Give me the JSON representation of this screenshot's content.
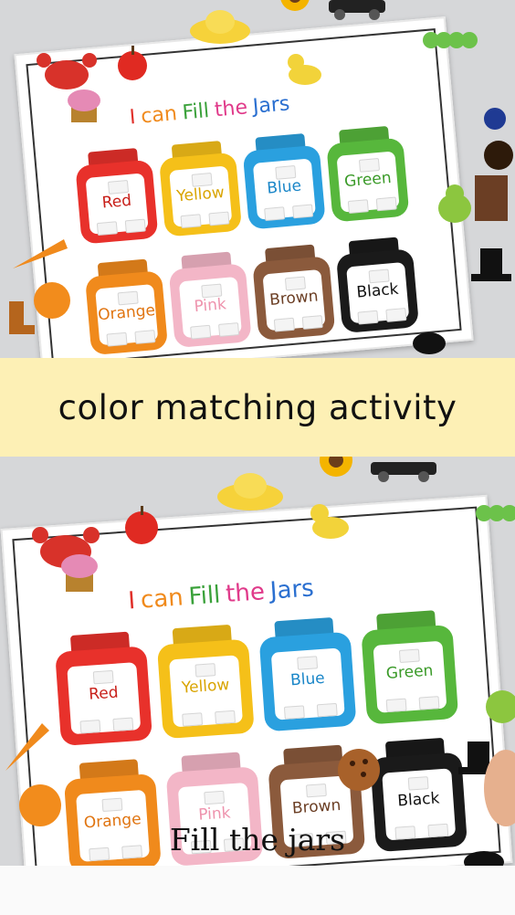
{
  "banner": {
    "text": "color matching activity"
  },
  "sheet": {
    "title_words": [
      {
        "text": "I",
        "color": "#e0302a"
      },
      {
        "text": "can",
        "color": "#f08a1c"
      },
      {
        "text": "Fill",
        "color": "#3aa13a"
      },
      {
        "text": "the",
        "color": "#e03a8a"
      },
      {
        "text": "Jars",
        "color": "#2a6fd0"
      }
    ],
    "jars": [
      {
        "name": "Red",
        "color": "#e8312b",
        "text_color": "#c8201a"
      },
      {
        "name": "Yellow",
        "color": "#f5c019",
        "text_color": "#d9a400"
      },
      {
        "name": "Blue",
        "color": "#2aa0df",
        "text_color": "#1a86c8"
      },
      {
        "name": "Green",
        "color": "#57b73c",
        "text_color": "#3a9a28"
      },
      {
        "name": "Orange",
        "color": "#f08a1c",
        "text_color": "#e07410"
      },
      {
        "name": "Pink",
        "color": "#f3b6c7",
        "text_color": "#ee93ad"
      },
      {
        "name": "Brown",
        "color": "#8b5a3c",
        "text_color": "#6b3e24"
      },
      {
        "name": "Black",
        "color": "#1a1a1a",
        "text_color": "#111111"
      }
    ]
  },
  "caption": {
    "text": "Fill the jars"
  }
}
